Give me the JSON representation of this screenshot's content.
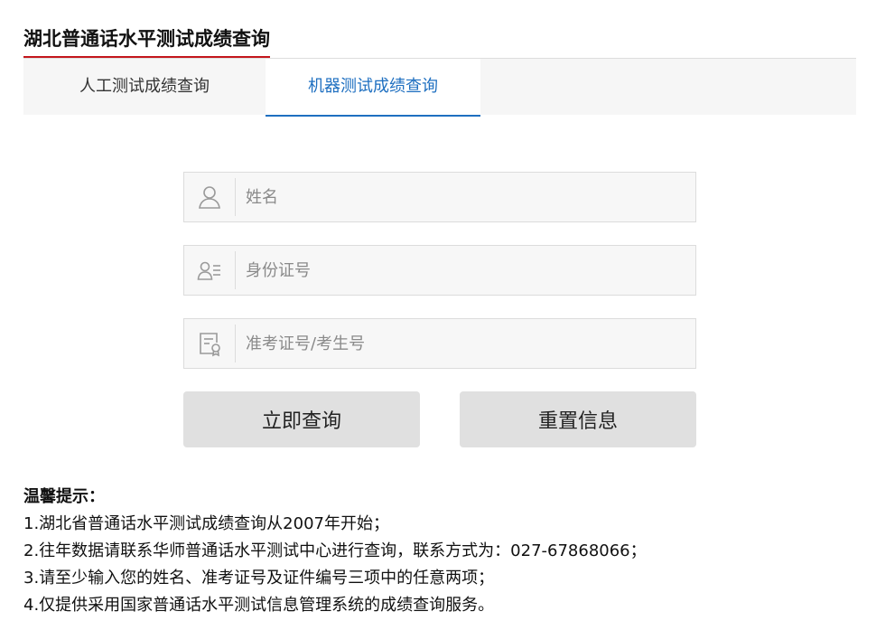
{
  "page": {
    "title": "湖北普通话水平测试成绩查询"
  },
  "tabs": [
    {
      "label": "人工测试成绩查询",
      "active": false
    },
    {
      "label": "机器测试成绩查询",
      "active": true
    }
  ],
  "form": {
    "name": {
      "icon": "user-icon",
      "placeholder": "姓名",
      "value": ""
    },
    "id_card": {
      "icon": "id-card-icon",
      "placeholder": "身份证号",
      "value": ""
    },
    "exam_no": {
      "icon": "certificate-icon",
      "placeholder": "准考证号/考生号",
      "value": ""
    }
  },
  "buttons": {
    "query_label": "立即查询",
    "reset_label": "重置信息"
  },
  "tips": {
    "title": "温馨提示：",
    "lines": [
      "1.湖北省普通话水平测试成绩查询从2007年开始；",
      "2.往年数据请联系华师普通话水平测试中心进行查询，联系方式为：027-67868066；",
      "3.请至少输入您的姓名、准考证号及证件编号三项中的任意两项；",
      "4.仅提供采用国家普通话水平测试信息管理系统的成绩查询服务。"
    ]
  },
  "colors": {
    "title_underline": "#c4161c",
    "active_tab": "#1e6fc0",
    "button_bg": "#e0e0e0",
    "field_bg": "#f7f7f7"
  }
}
